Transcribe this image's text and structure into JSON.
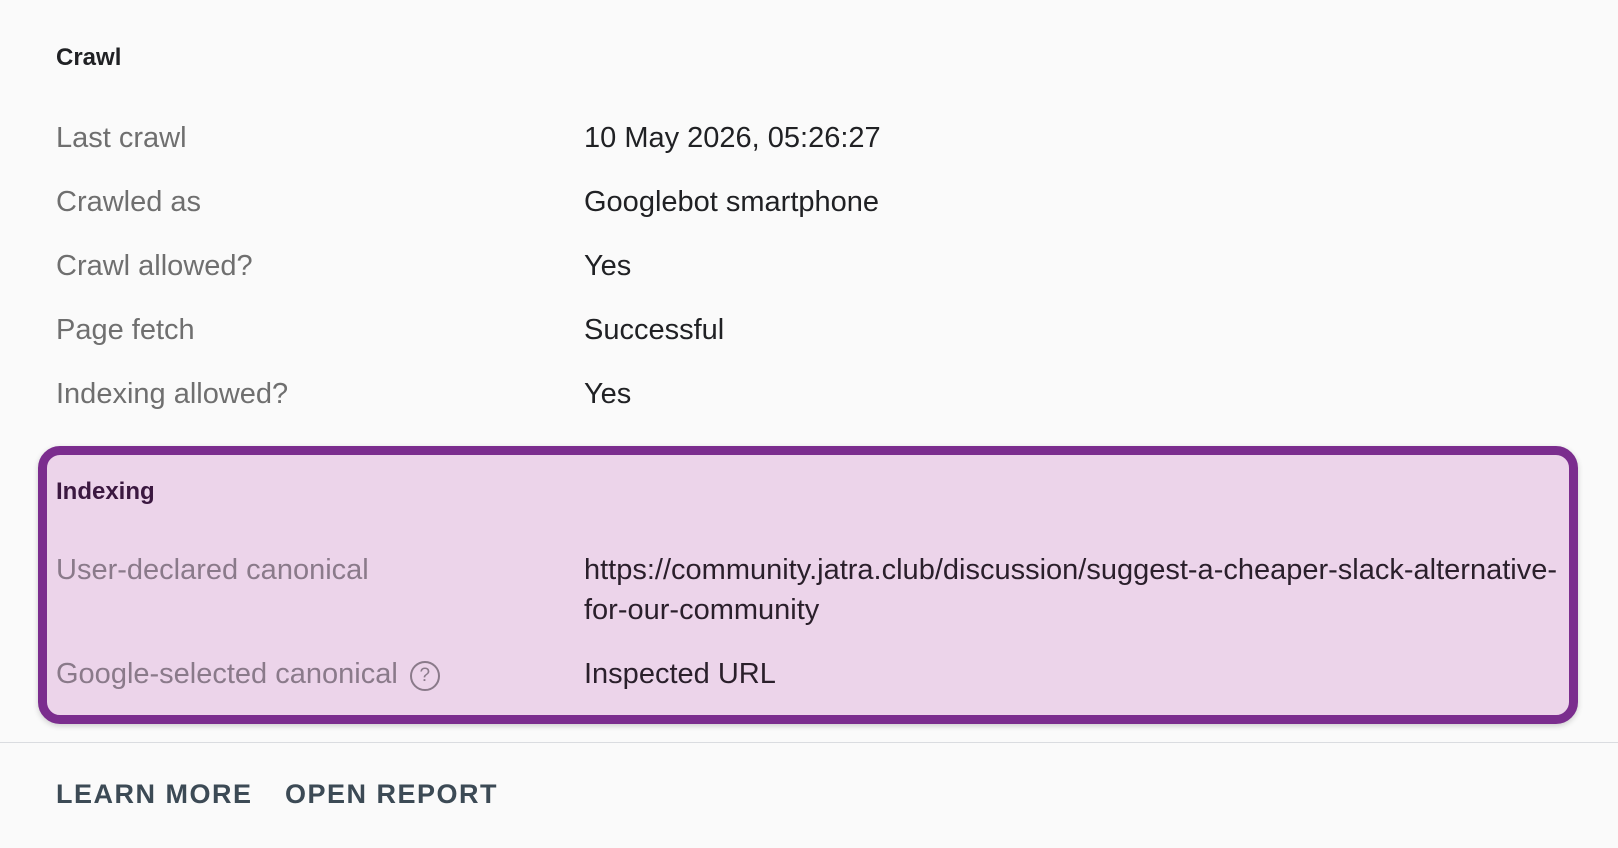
{
  "crawl": {
    "title": "Crawl",
    "rows": [
      {
        "label": "Last crawl",
        "value": "10 May 2026, 05:26:27"
      },
      {
        "label": "Crawled as",
        "value": "Googlebot smartphone"
      },
      {
        "label": "Crawl allowed?",
        "value": "Yes"
      },
      {
        "label": "Page fetch",
        "value": "Successful"
      },
      {
        "label": "Indexing allowed?",
        "value": "Yes"
      }
    ]
  },
  "indexing": {
    "title": "Indexing",
    "rows": [
      {
        "label": "User-declared canonical",
        "value": "https://community.jatra.club/discussion/suggest-a-cheaper-slack-alternative-for-our-community"
      },
      {
        "label": "Google-selected canonical",
        "value": "Inspected URL",
        "icon": "help-circle-icon",
        "icon_glyph": "?"
      }
    ],
    "highlight_border_color": "#7b2d8e",
    "highlight_fill_color": "#ecd4ea"
  },
  "actions": {
    "learn_more": "LEARN MORE",
    "open_report": "OPEN REPORT"
  }
}
